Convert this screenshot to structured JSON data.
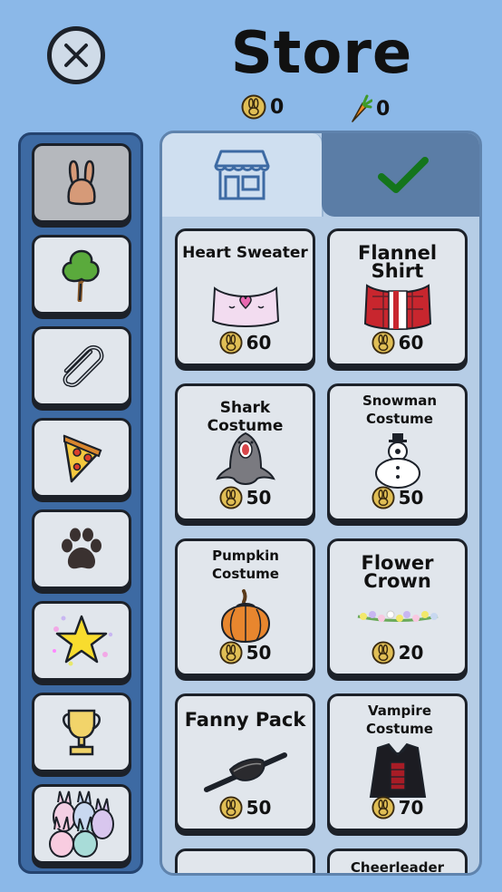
{
  "header": {
    "title": "Store",
    "close_icon": "close-icon"
  },
  "currency": {
    "coins": "0",
    "carrots": "0"
  },
  "categories": [
    {
      "name": "bunny",
      "icon": "bunny-icon",
      "selected": true
    },
    {
      "name": "tree",
      "icon": "tree-icon"
    },
    {
      "name": "paperclip",
      "icon": "paperclip-icon"
    },
    {
      "name": "pizza",
      "icon": "pizza-icon"
    },
    {
      "name": "paw",
      "icon": "paw-icon"
    },
    {
      "name": "star",
      "icon": "star-icon"
    },
    {
      "name": "trophy",
      "icon": "trophy-icon"
    },
    {
      "name": "bunny-group",
      "icon": "bunny-group-icon"
    }
  ],
  "tabs": {
    "store_icon": "storefront-icon",
    "owned_icon": "checkmark-icon"
  },
  "items": [
    {
      "name": "Heart Sweater",
      "price": "60"
    },
    {
      "name": "Flannel Shirt",
      "price": "60"
    },
    {
      "name": "Shark Costume",
      "price": "50"
    },
    {
      "name": "Snowman Costume",
      "price": "50"
    },
    {
      "name": "Pumpkin Costume",
      "price": "50"
    },
    {
      "name": "Flower Crown",
      "price": "20"
    },
    {
      "name": "Fanny Pack",
      "price": "50"
    },
    {
      "name": "Vampire Costume",
      "price": "70"
    },
    {
      "name": "",
      "price": ""
    },
    {
      "name": "Cheerleader",
      "price": ""
    }
  ],
  "colors": {
    "background": "#8bb8e8",
    "sidebar": "#3d6aa3",
    "panel": "#b6cde6",
    "card": "#e1e6ec",
    "check_green": "#1a7a1a"
  }
}
